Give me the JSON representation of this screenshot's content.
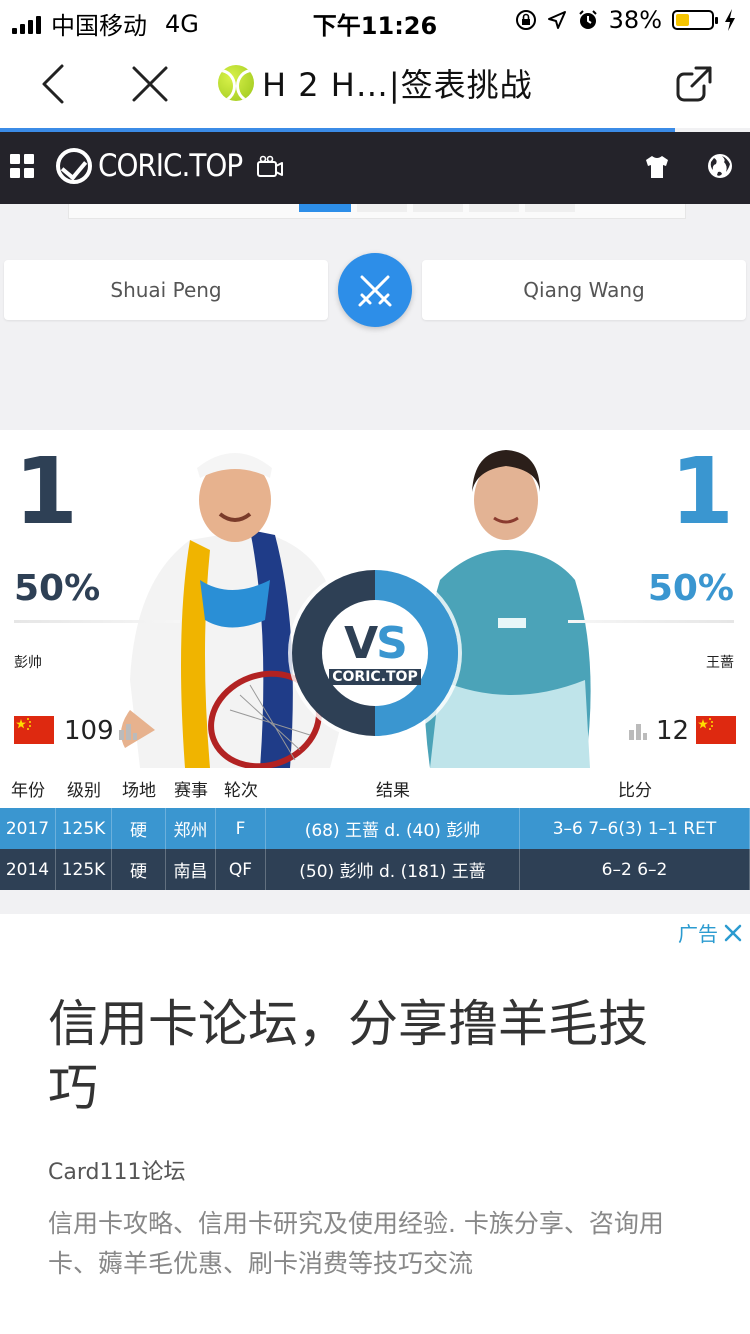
{
  "status_bar": {
    "carrier": "中国移动",
    "network": "4G",
    "time": "下午11:26",
    "battery": "38%",
    "battery_level": 0.38
  },
  "nav": {
    "title": "H 2 H…|签表挑战"
  },
  "page_progress": 0.9,
  "site": {
    "logo": "CORIC.TOP"
  },
  "players": {
    "left_name": "Shuai Peng",
    "right_name": "Qiang Wang"
  },
  "compare": {
    "left": {
      "wins": "1",
      "pct": "50%",
      "cn_name": "彭帅",
      "rank": "109",
      "color": "#2e4055"
    },
    "right": {
      "wins": "1",
      "pct": "50%",
      "cn_name": "王蔷",
      "rank": "12",
      "color": "#3a96d0"
    },
    "vs_text": "VS",
    "vs_sub": "CORIC.TOP"
  },
  "table": {
    "headers": [
      "年份",
      "级别",
      "场地",
      "赛事",
      "轮次",
      "结果",
      "比分"
    ],
    "rows": [
      [
        "2017",
        "125K",
        "硬",
        "郑州",
        "F",
        "(68) 王蔷 d. (40) 彭帅",
        "3–6 7–6(3) 1–1 RET"
      ],
      [
        "2014",
        "125K",
        "硬",
        "南昌",
        "QF",
        "(50) 彭帅 d. (181) 王蔷",
        "6–2 6–2"
      ]
    ]
  },
  "ad": {
    "tag": "广告",
    "headline": "信用卡论坛，分享撸羊毛技巧",
    "source": "Card111论坛",
    "description": "信用卡攻略、信用卡研究及使用经验. 卡族分享、咨询用卡、薅羊毛优惠、刷卡消费等技巧交流"
  }
}
